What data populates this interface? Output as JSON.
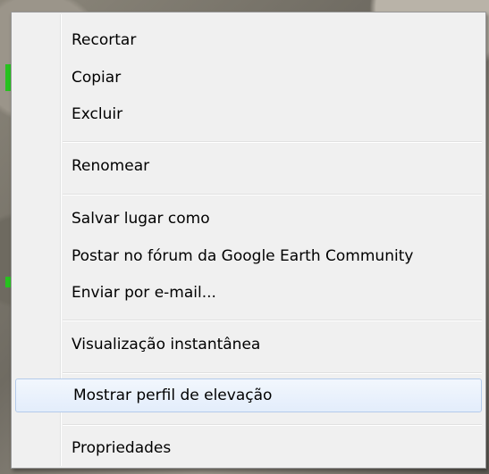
{
  "context_menu": {
    "items": [
      {
        "label": "Recortar"
      },
      {
        "label": "Copiar"
      },
      {
        "label": "Excluir"
      },
      {
        "label": "Renomear"
      },
      {
        "label": "Salvar lugar como"
      },
      {
        "label": "Postar no fórum da Google Earth Community"
      },
      {
        "label": "Enviar por e-mail..."
      },
      {
        "label": "Visualização instantânea"
      },
      {
        "label": "Mostrar perfil de elevação",
        "highlighted": true
      },
      {
        "label": "Propriedades"
      }
    ]
  },
  "colors": {
    "menu_background": "#f0f0f0",
    "menu_border": "#979797",
    "highlight_border": "#b4cbeb",
    "highlight_fill": "#e3edfb",
    "map_marker": "#27c21f"
  }
}
